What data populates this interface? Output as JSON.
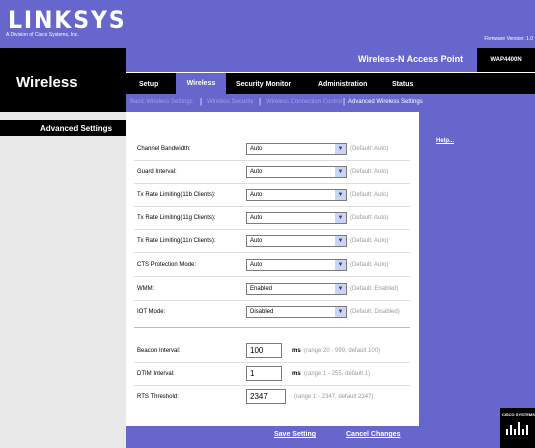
{
  "header": {
    "logo": "LINKSYS",
    "logo_sub": "A Division of Cisco Systems, Inc.",
    "firmware": "Firmware Version: 1.0",
    "section_title": "Wireless",
    "product_name": "Wireless-N Access Point",
    "model": "WAP4400N"
  },
  "main_tabs": [
    {
      "label": "Setup"
    },
    {
      "label": "Wireless"
    },
    {
      "label": "Security Monitor"
    },
    {
      "label": "Administration"
    },
    {
      "label": "Status"
    }
  ],
  "sub_tabs": [
    {
      "label": "Basic Wireless Settings"
    },
    {
      "label": "Wireless Security"
    },
    {
      "label": "Wireless Connection Control"
    },
    {
      "label": "Advanced Wireless Settings"
    }
  ],
  "sidebar": {
    "label": "Advanced Settings"
  },
  "help": {
    "label": "Help..."
  },
  "settings": [
    {
      "label": "Channel Bandwidth:",
      "value": "Auto",
      "hint": "(Default: Auto)"
    },
    {
      "label": "Guard Interval:",
      "value": "Auto",
      "hint": "(Default: Auto)"
    },
    {
      "label": "Tx Rate Limiting(11b Clients):",
      "value": "Auto",
      "hint": "(Default: Auto)"
    },
    {
      "label": "Tx Rate Limiting(11g Clients):",
      "value": "Auto",
      "hint": "(Default: Auto)"
    },
    {
      "label": "Tx Rate Limiting(11n Clients):",
      "value": "Auto",
      "hint": "(Default: Auto)"
    },
    {
      "label": "CTS Protection Mode:",
      "value": "Auto",
      "hint": "(Default: Auto)"
    },
    {
      "label": "WMM:",
      "value": "Enabled",
      "hint": "(Default: Enabled)"
    },
    {
      "label": "IOT Mode:",
      "value": "Disabled",
      "hint": "(Default: Disabled)"
    }
  ],
  "intervals": [
    {
      "label": "Beacon Interval:",
      "value": "100",
      "unit": "ms",
      "range": "(range 20 - 999, default 100)"
    },
    {
      "label": "DTIM Interval:",
      "value": "1",
      "unit": "ms",
      "range": "(range 1 - 255, default 1)"
    },
    {
      "label": "RTS Threshold:",
      "value": "2347",
      "unit": "",
      "range": "(range 1 - 2347, default 2347)"
    }
  ],
  "buttons": {
    "save": "Save Setting",
    "cancel": "Cancel Changes"
  },
  "footer": {
    "brand": "CISCO SYSTEMS"
  },
  "colors": {
    "brand_purple": "#6666cc",
    "black": "#000000",
    "sidebar_gray": "#e8e8e8"
  }
}
